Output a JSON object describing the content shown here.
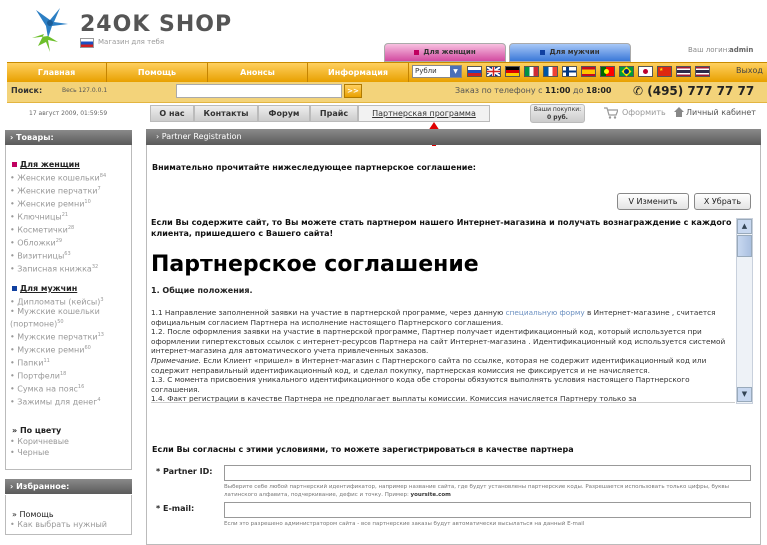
{
  "header": {
    "logo_text": "24OK SHOP",
    "logo_sub": "Магазин для тебя",
    "tab_women": "Для женщин",
    "tab_men": "Для мужчин",
    "login_label": "Ваш логин:",
    "login_user": "admin"
  },
  "nav": {
    "items": [
      "Главная",
      "Помощь",
      "Анонсы",
      "Информация"
    ],
    "currency": "Рубли",
    "logout": "Выход",
    "flags": [
      "ru",
      "gb",
      "de",
      "it",
      "fr",
      "fi",
      "es",
      "pt",
      "br",
      "jp",
      "cn",
      "th"
    ]
  },
  "search": {
    "label": "Поиск:",
    "scope": "Весь 127.0.0.1",
    "button": ">>",
    "phone_prefix": "Заказ по телефону с ",
    "phone_from": "11:00",
    "phone_mid": " до ",
    "phone_to": "18:00",
    "phone_number": "(495) 777 77 77"
  },
  "subnav": {
    "date": "17 август 2009, 01:59:59",
    "tabs": [
      "О нас",
      "Контакты",
      "Форум",
      "Прайс",
      "Партнерская программа"
    ],
    "cart_label": "Ваши покупки:",
    "cart_value": "0 руб.",
    "checkout": "Оформить",
    "cabinet": "Личный кабинет"
  },
  "sidebar": {
    "goods_title": "Товары:",
    "women_title": "Для женщин",
    "women_items": [
      {
        "label": "Женские кошельки",
        "count": "84"
      },
      {
        "label": "Женские перчатки",
        "count": "7"
      },
      {
        "label": "Женские ремни",
        "count": "10"
      },
      {
        "label": "Ключницы",
        "count": "21"
      },
      {
        "label": "Косметички",
        "count": "28"
      },
      {
        "label": "Обложки",
        "count": "29"
      },
      {
        "label": "Визитницы",
        "count": "63"
      },
      {
        "label": "Записная книжка",
        "count": "32"
      }
    ],
    "men_title": "Для мужчин",
    "men_items": [
      {
        "label": "Дипломаты (кейсы)",
        "count": "3"
      },
      {
        "label": "Мужские кошельки (портмоне)",
        "count": "50"
      },
      {
        "label": "Мужские перчатки",
        "count": "13"
      },
      {
        "label": "Мужские ремни",
        "count": "60"
      },
      {
        "label": "Папки",
        "count": "11"
      },
      {
        "label": "Портфели",
        "count": "18"
      },
      {
        "label": "Сумка на пояс",
        "count": "16"
      },
      {
        "label": "Зажимы для денег",
        "count": "4"
      }
    ],
    "by_color_title": "По цвету",
    "colors": [
      "Коричневые",
      "Черные"
    ],
    "fav_title": "Избранное:",
    "fav_items": [
      "Помощь",
      "Как выбрать нужный"
    ]
  },
  "main": {
    "title": "Partner Registration",
    "intro": "Внимательно прочитайте нижеследующее партнерское соглашение:",
    "edit_button": "Изменить",
    "remove_button": "Убрать",
    "lead": "Если Вы содержите сайт, то Вы можете стать партнером нашего Интернет-магазина и получать вознаграждение с каждого клиента, пришедшего с Вашего сайта!",
    "heading": "Партнерское соглашение",
    "section": "1. Общие положения.",
    "p1_a": "1.1 Направление заполненной заявки на участие в партнерской программе, через данную ",
    "p1_link": "специальную форму",
    "p1_b": " в Интернет-магазине , считается официальным согласием Партнера на исполнение настоящего Партнерского соглашения.",
    "p2": "1.2. После оформления заявки на участие в партнерской программе, Партнер получает идентификационный код, который используется при оформлении гипертекстовых ссылок с интернет-ресурсов Партнера на сайт Интернет-магазина . Идентификационный код используется системой интернет-магазина для автоматического учета привлеченных заказов.",
    "p3_em": "Примечание.",
    "p3": " Если Клиент «пришел» в Интернет-магазин с Партнерского сайта по ссылке, которая не содержит идентификационный код или содержит неправильный идентификационный код, и сделал покупку, партнерская комиссия не фиксируется и не начисляется.",
    "p4": "1.3. С момента присвоения уникального идентификационного кода обе стороны обязуются выполнять условия настоящего Партнерского соглашения.",
    "p5": "1.4. Факт регистрации в качестве Партнера не предполагает выплаты комиссии. Комиссия начисляется Партнеру только за",
    "agree": "Если Вы согласны с этими условиями, то можете зарегистрироваться в качестве партнера",
    "partner_id_label": "Partner ID:",
    "partner_id_hint_a": "Выберите себе любой партнерский идентификатор, например название сайта, где будут установлены партнерские коды. Разрешается использовать только цифры, буквы латинского алфавита, подчеркивание, дефис и точку. Пример: ",
    "partner_id_hint_example": "yoursite.com",
    "email_label": "E-mail:",
    "email_hint": "Если это разрешено администратором сайта - все партнерские заказы будут автоматически высылаться на данный E-mail"
  }
}
